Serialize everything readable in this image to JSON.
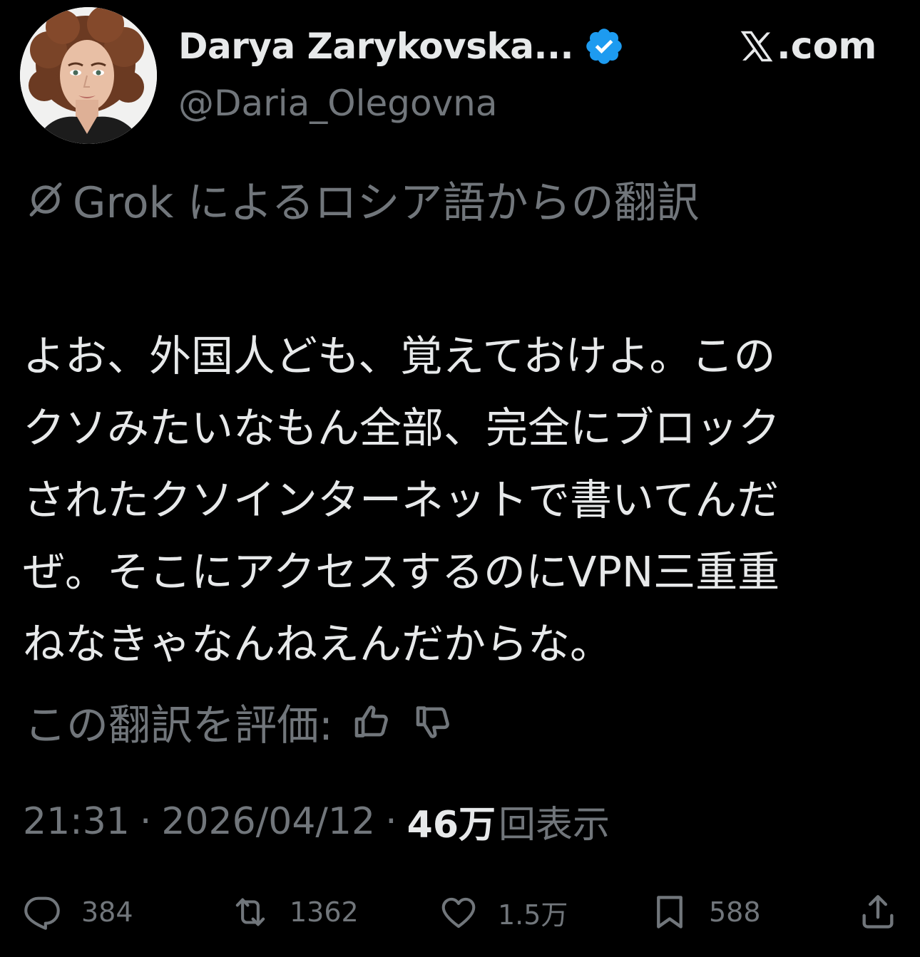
{
  "author": {
    "display_name": "Darya Zarykovska...",
    "handle": "@Daria_Olegovna",
    "verified": true,
    "verified_color": "#1d9bf0"
  },
  "site_label": ".com",
  "translation": {
    "label": "Grok によるロシア語からの翻訳",
    "rate_label": "この翻訳を評価:"
  },
  "tweet": {
    "lines": [
      "よお、外国人ども、覚えておけよ。この",
      "クソみたいなもん全部、完全にブロック",
      "されたクソインターネットで書いてんだ",
      "ぜ。そこにアクセスするのにVPN三重重",
      "ねなきゃなんねえんだからな。"
    ]
  },
  "meta": {
    "time": "21:31",
    "date": "2026/04/12",
    "views_count": "46万",
    "views_label": "回表示"
  },
  "actions": {
    "replies": "384",
    "reposts": "1362",
    "likes": "1.5万",
    "bookmarks": "588"
  },
  "colors": {
    "background": "#000000",
    "primary_text": "#e7e9ea",
    "secondary_text": "#71767b"
  }
}
